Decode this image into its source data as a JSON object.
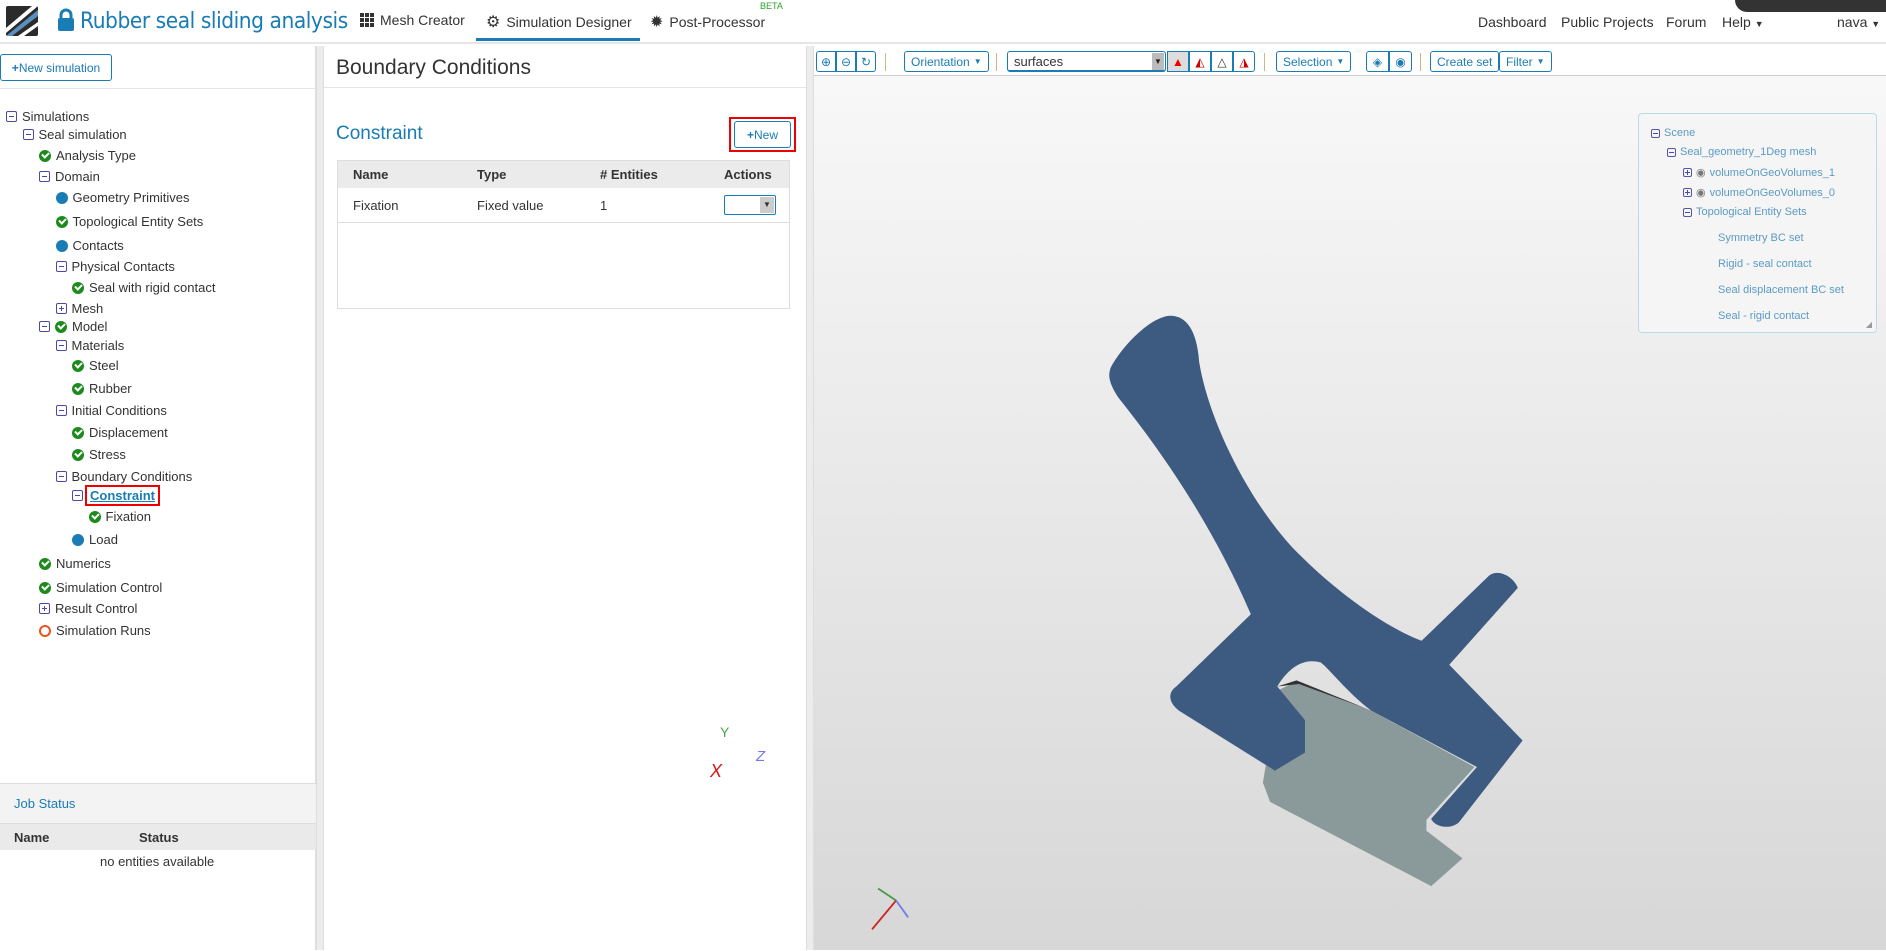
{
  "header": {
    "title": "Rubber seal sliding analysis",
    "tabs": [
      {
        "label": "Mesh Creator",
        "icon": "grid-icon"
      },
      {
        "label": "Simulation Designer",
        "icon": "gears-icon",
        "active": true
      },
      {
        "label": "Post-Processor",
        "icon": "gear-icon",
        "badge": "BETA"
      }
    ],
    "links": [
      "Dashboard",
      "Public Projects",
      "Forum",
      "Help"
    ],
    "user": "nava"
  },
  "left": {
    "new_simulation": "New simulation",
    "tree": [
      {
        "label": "Simulations",
        "icon": "minus"
      },
      {
        "label": "Seal simulation",
        "icon": "minus"
      },
      {
        "label": "Analysis Type",
        "icon": "check"
      },
      {
        "label": "Domain",
        "icon": "minus"
      },
      {
        "label": "Geometry Primitives",
        "icon": "dot"
      },
      {
        "label": "Topological Entity Sets",
        "icon": "check"
      },
      {
        "label": "Contacts",
        "icon": "dot"
      },
      {
        "label": "Physical Contacts",
        "icon": "minus"
      },
      {
        "label": "Seal with rigid contact",
        "icon": "check"
      },
      {
        "label": "Mesh",
        "icon": "plus"
      },
      {
        "label": "Model",
        "icon": "minus+check"
      },
      {
        "label": "Materials",
        "icon": "minus"
      },
      {
        "label": "Steel",
        "icon": "check"
      },
      {
        "label": "Rubber",
        "icon": "check"
      },
      {
        "label": "Initial Conditions",
        "icon": "minus"
      },
      {
        "label": "Displacement",
        "icon": "check"
      },
      {
        "label": "Stress",
        "icon": "check"
      },
      {
        "label": "Boundary Conditions",
        "icon": "minus"
      },
      {
        "label": "Constraint",
        "icon": "minus",
        "selected": true
      },
      {
        "label": "Fixation",
        "icon": "check"
      },
      {
        "label": "Load",
        "icon": "dot"
      },
      {
        "label": "Numerics",
        "icon": "check"
      },
      {
        "label": "Simulation Control",
        "icon": "check"
      },
      {
        "label": "Result Control",
        "icon": "plus"
      },
      {
        "label": "Simulation Runs",
        "icon": "ring"
      }
    ],
    "job_status": {
      "title": "Job Status",
      "columns": [
        "Name",
        "Status"
      ],
      "empty": "no entities available"
    }
  },
  "mid": {
    "title": "Boundary Conditions",
    "section": "Constraint",
    "new_button": "New",
    "columns": [
      "Name",
      "Type",
      "# Entities",
      "Actions"
    ],
    "rows": [
      {
        "name": "Fixation",
        "type": "Fixed value",
        "entities": "1"
      }
    ]
  },
  "viewer": {
    "orientation": "Orientation",
    "render_mode": "surfaces",
    "selection": "Selection",
    "create_set": "Create set",
    "filter": "Filter",
    "scene": {
      "root": "Scene",
      "mesh": "Seal_geometry_1Deg mesh",
      "volumes": [
        "volumeOnGeoVolumes_1",
        "volumeOnGeoVolumes_0"
      ],
      "sets_label": "Topological Entity Sets",
      "sets": [
        "Symmetry BC set",
        "Rigid - seal contact",
        "Seal displacement BC set",
        "Seal - rigid contact"
      ]
    },
    "axes": {
      "x": "X",
      "y": "Y",
      "z": "Z"
    },
    "colors": {
      "seal": "#3d5a80",
      "rigid": "#8a9a9a",
      "accent": "#1a7cb5"
    }
  }
}
